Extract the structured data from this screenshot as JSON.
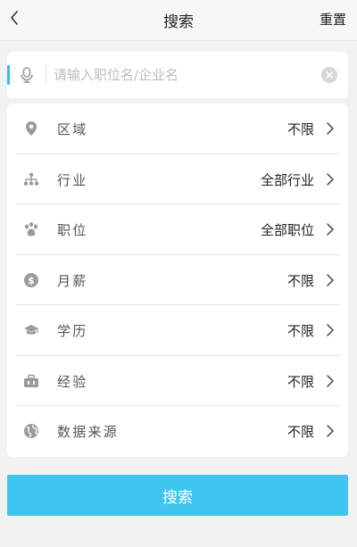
{
  "navbar": {
    "back_icon": "chevron-left-icon",
    "title": "搜索",
    "reset_label": "重置"
  },
  "search": {
    "placeholder": "请输入职位名/企业名",
    "value": "",
    "mic_icon": "microphone-icon",
    "clear_icon": "clear-circle-icon"
  },
  "filters": [
    {
      "icon": "location-pin-icon",
      "label": "区域",
      "value": "不限"
    },
    {
      "icon": "org-chart-icon",
      "label": "行业",
      "value": "全部行业"
    },
    {
      "icon": "paw-icon",
      "label": "职位",
      "value": "全部职位"
    },
    {
      "icon": "dollar-coin-icon",
      "label": "月薪",
      "value": "不限"
    },
    {
      "icon": "graduation-cap-icon",
      "label": "学历",
      "value": "不限"
    },
    {
      "icon": "briefcase-icon",
      "label": "经验",
      "value": "不限"
    },
    {
      "icon": "globe-icon",
      "label": "数据来源",
      "value": "不限"
    }
  ],
  "submit": {
    "label": "搜索"
  },
  "colors": {
    "accent": "#35c2e8",
    "button": "#3ec6ee",
    "background": "#f2f2f2",
    "icon": "#9a9a9a"
  }
}
